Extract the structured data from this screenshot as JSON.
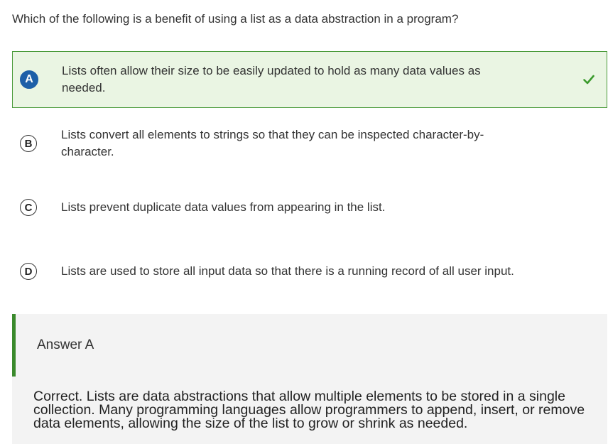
{
  "question": "Which of the following is a benefit of using a list as a data abstraction in a program?",
  "options": [
    {
      "letter": "A",
      "text": "Lists often allow their size to be easily updated to hold as many data values as needed.",
      "state": "correct"
    },
    {
      "letter": "B",
      "text": "Lists convert all elements to strings so that they can be inspected character-by-character.",
      "state": "none"
    },
    {
      "letter": "C",
      "text": "Lists prevent duplicate data values from appearing in the list.",
      "state": "none"
    },
    {
      "letter": "D",
      "text": "Lists are used to store all input data so that there is a running record of all user input.",
      "state": "none"
    }
  ],
  "answer": {
    "title": "Answer A",
    "explanation": "Correct. Lists are data abstractions that allow multiple elements to be stored in a single collection. Many programming languages allow programmers to append, insert, or remove data elements, allowing the size of the list to grow or shrink as needed."
  },
  "colors": {
    "correct_border": "#4a9a3a",
    "correct_bg": "#eaf5e3",
    "selected_letter_bg": "#1d5fa8",
    "check": "#3a9a2c",
    "answer_bar": "#3a8a2c",
    "answer_bg": "#f3f3f3"
  },
  "icons": {
    "correct_mark": "checkmark-icon"
  }
}
